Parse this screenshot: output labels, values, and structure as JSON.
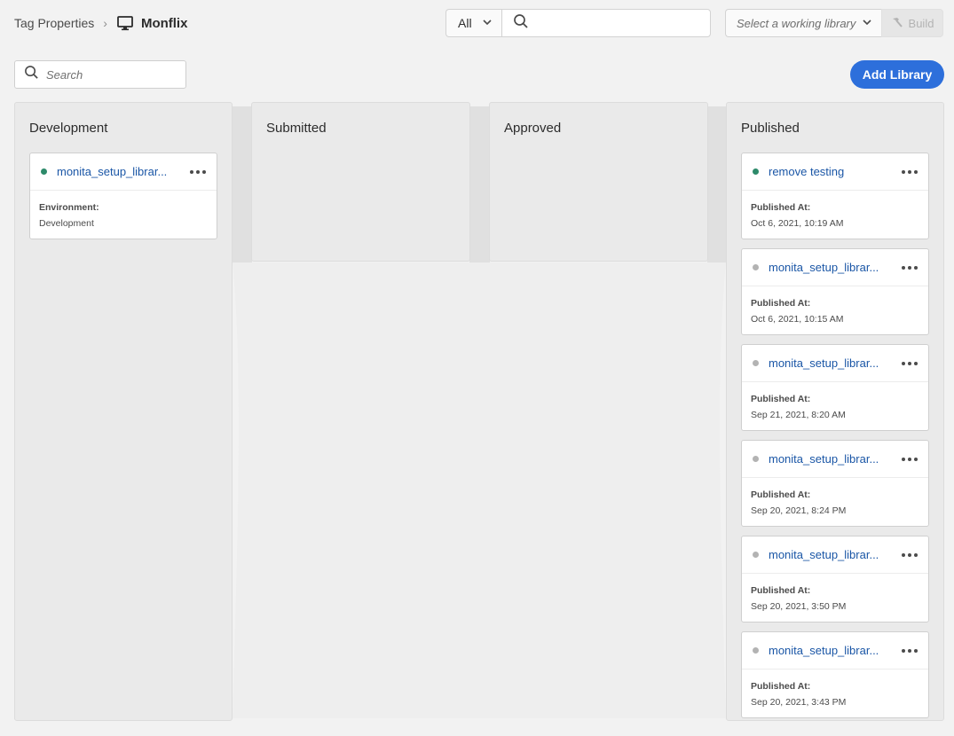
{
  "header": {
    "breadcrumb_root": "Tag Properties",
    "breadcrumb_separator": "›",
    "property_name": "Monflix",
    "property_icon": "monitor-icon"
  },
  "filter": {
    "type_value": "All",
    "search_placeholder": ""
  },
  "library_picker": {
    "placeholder": "Select a working library",
    "build_label": "Build"
  },
  "search": {
    "placeholder": "Search"
  },
  "add_library_label": "Add Library",
  "colors": {
    "accent": "#2d6fdb",
    "active_dot": "#2d8a6a",
    "inactive_dot": "#b3b3b3",
    "link": "#1a56a6"
  },
  "columns": {
    "development": {
      "title": "Development",
      "cards": [
        {
          "name": "monita_setup_librar...",
          "status": "active",
          "label": "Environment:",
          "value": "Development"
        }
      ]
    },
    "submitted": {
      "title": "Submitted",
      "cards": []
    },
    "approved": {
      "title": "Approved",
      "cards": []
    },
    "published": {
      "title": "Published",
      "cards": [
        {
          "name": "remove testing",
          "status": "active",
          "label": "Published At:",
          "value": "Oct 6, 2021, 10:19 AM"
        },
        {
          "name": "monita_setup_librar...",
          "status": "inactive",
          "label": "Published At:",
          "value": "Oct 6, 2021, 10:15 AM"
        },
        {
          "name": "monita_setup_librar...",
          "status": "inactive",
          "label": "Published At:",
          "value": "Sep 21, 2021, 8:20 AM"
        },
        {
          "name": "monita_setup_librar...",
          "status": "inactive",
          "label": "Published At:",
          "value": "Sep 20, 2021, 8:24 PM"
        },
        {
          "name": "monita_setup_librar...",
          "status": "inactive",
          "label": "Published At:",
          "value": "Sep 20, 2021, 3:50 PM"
        },
        {
          "name": "monita_setup_librar...",
          "status": "inactive",
          "label": "Published At:",
          "value": "Sep 20, 2021, 3:43 PM"
        }
      ]
    }
  }
}
